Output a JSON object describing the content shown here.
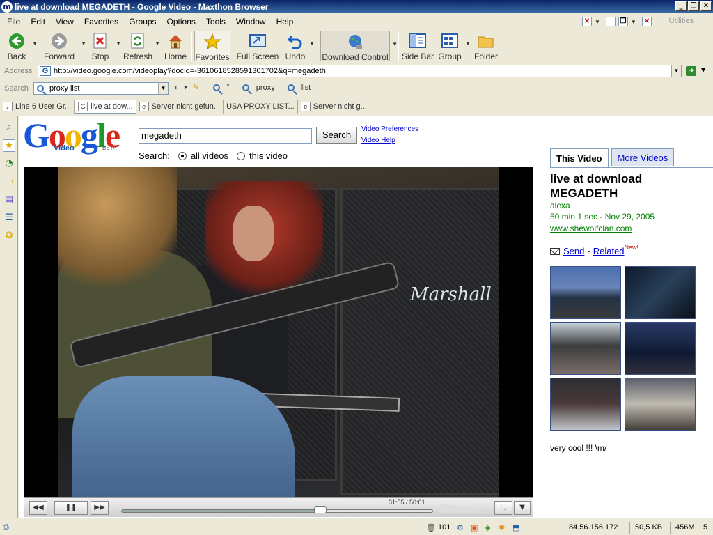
{
  "window": {
    "title": "live at download MEGADETH - Google Video - Maxthon Browser",
    "app_icon": "m"
  },
  "menubar": {
    "items": [
      "File",
      "Edit",
      "View",
      "Favorites",
      "Groups",
      "Options",
      "Tools",
      "Window",
      "Help"
    ],
    "utilities_label": "Utilities"
  },
  "toolbar": {
    "back": "Back",
    "forward": "Forward",
    "stop": "Stop",
    "refresh": "Refresh",
    "home": "Home",
    "favorites": "Favorites",
    "full_screen": "Full Screen",
    "undo": "Undo",
    "download_control": "Download Control",
    "side_bar": "Side Bar",
    "group": "Group",
    "folder": "Folder"
  },
  "address": {
    "label": "Address",
    "url": "http://video.google.com/videoplay?docid=-3610618528591301702&q=megadeth"
  },
  "searchbar": {
    "label": "Search",
    "value": "proxy list",
    "term1": "proxy",
    "term2": "list"
  },
  "tabs": [
    {
      "label": "Line 6 User Gr..."
    },
    {
      "label": "live at dow..."
    },
    {
      "label": "Server nicht gefun..."
    },
    {
      "label": "USA PROXY LIST..."
    },
    {
      "label": "Server nicht g..."
    }
  ],
  "google": {
    "logo_text": "Google",
    "logo_sub": "Video",
    "logo_beta": "BETA",
    "query": "megadeth",
    "search_button": "Search",
    "video_preferences": "Video Preferences",
    "video_help": "Video Help",
    "search_label": "Search:",
    "scope_all": "all videos",
    "scope_this": "this video"
  },
  "player": {
    "time": "31:55 / 50:01",
    "progress_fraction": 0.638,
    "amp_brand": "Marshall"
  },
  "video_info": {
    "tab_this": "This Video",
    "tab_more": "More Videos",
    "title": "live at download MEGADETH",
    "author": "alexa",
    "meta": "50 min 1 sec - Nov 29, 2005",
    "url": "www.shewolfclan.com",
    "send": "Send",
    "dash": "-",
    "related": "Related",
    "new_badge": "New!",
    "comment": "very cool !!! \\m/"
  },
  "statusbar": {
    "count": "101",
    "ip": "84.56.156.172",
    "size": "50,5 KB",
    "memory": "456M",
    "extra": "5"
  }
}
